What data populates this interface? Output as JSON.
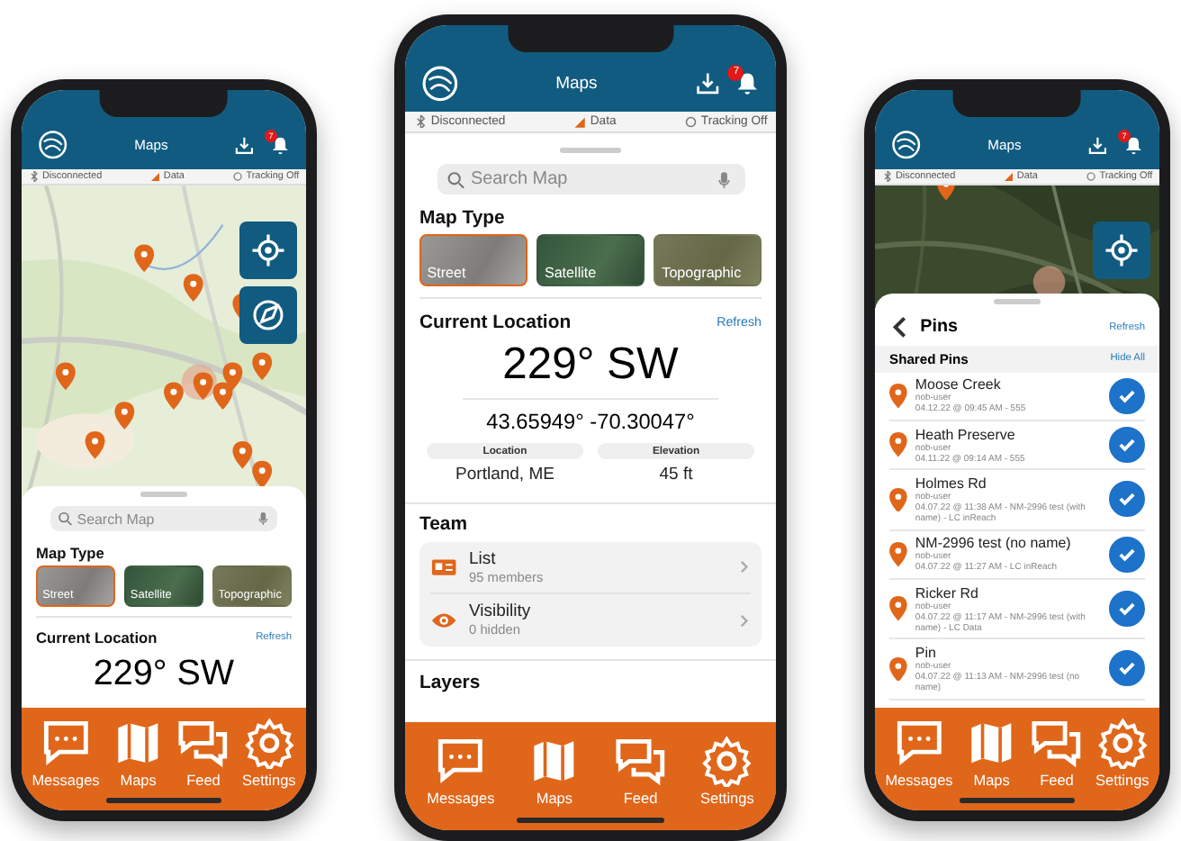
{
  "phones": [
    {
      "kind": "map",
      "header": {
        "title": "Maps",
        "badge": "7"
      },
      "status": [
        {
          "kind": "bluetooth",
          "label": "Disconnected"
        },
        {
          "kind": "data",
          "label": "Data"
        },
        {
          "kind": "tracking",
          "label": "Tracking Off"
        }
      ],
      "map": {
        "kind": "picture"
      },
      "search": {
        "placeholder": "Search Map"
      },
      "map_type": {
        "title": "Map Type",
        "options": [
          {
            "label": "Street",
            "selected": true
          },
          {
            "label": "Satellite",
            "selected": false
          },
          {
            "label": "Topographic",
            "selected": false
          }
        ]
      },
      "location": {
        "title": "Current Location",
        "refresh": "Refresh",
        "heading": "229° SW"
      },
      "tabs": [
        "Messages",
        "Maps",
        "Feed",
        "Settings"
      ]
    },
    {
      "kind": "location",
      "header": {
        "title": "Maps",
        "badge": "7"
      },
      "status": [
        {
          "kind": "bluetooth",
          "label": "Disconnected"
        },
        {
          "kind": "data",
          "label": "Data"
        },
        {
          "kind": "tracking",
          "label": "Tracking Off"
        }
      ],
      "search": {
        "placeholder": "Search Map"
      },
      "map_type": {
        "title": "Map Type",
        "options": [
          {
            "label": "Street",
            "selected": true
          },
          {
            "label": "Satellite",
            "selected": false
          },
          {
            "label": "Topographic",
            "selected": false
          }
        ]
      },
      "location": {
        "title": "Current Location",
        "refresh": "Refresh",
        "heading": "229° SW",
        "coordinates": "43.65949° -70.30047°",
        "stats": [
          {
            "label": "Location",
            "value": "Portland, ME"
          },
          {
            "label": "Elevation",
            "value": "45 ft"
          }
        ]
      },
      "team": {
        "title": "Team",
        "items": [
          {
            "kind": "list",
            "title": "List",
            "subtitle": "95 members"
          },
          {
            "kind": "visibility",
            "title": "Visibility",
            "subtitle": "0 hidden"
          }
        ]
      },
      "layers": {
        "title": "Layers"
      },
      "tabs": [
        "Messages",
        "Maps",
        "Feed",
        "Settings"
      ]
    },
    {
      "kind": "pins",
      "header": {
        "title": "Maps",
        "badge": "7"
      },
      "status": [
        {
          "kind": "bluetooth",
          "label": "Disconnected"
        },
        {
          "kind": "data",
          "label": "Data"
        },
        {
          "kind": "tracking",
          "label": "Tracking Off"
        }
      ],
      "map": {
        "kind": "picture"
      },
      "pins": {
        "title": "Pins",
        "refresh": "Refresh",
        "group": "Shared Pins",
        "hide_all": "Hide All",
        "items": [
          {
            "title": "Moose Creek",
            "user": "nob-user",
            "detail": "04.12.22 @ 09:45 AM - 555",
            "checked": true
          },
          {
            "title": "Heath Preserve",
            "user": "nob-user",
            "detail": "04.11.22 @ 09:14 AM - 555",
            "checked": true
          },
          {
            "title": "Holmes Rd",
            "user": "nob-user",
            "detail": "04.07.22 @ 11:38 AM - NM-2996 test (with name) - LC inReach",
            "checked": true
          },
          {
            "title": "NM-2996 test (no name)",
            "user": "nob-user",
            "detail": "04.07.22 @ 11:27 AM - LC inReach",
            "checked": true
          },
          {
            "title": "Ricker Rd",
            "user": "nob-user",
            "detail": "04.07.22 @ 11:17 AM - NM-2996 test (with name) - LC Data",
            "checked": true
          },
          {
            "title": "Pin",
            "user": "nob-user",
            "detail": "04.07.22 @ 11:13 AM - NM-2996 test (no name)",
            "checked": true
          }
        ]
      },
      "tabs": [
        "Messages",
        "Maps",
        "Feed",
        "Settings"
      ]
    }
  ]
}
